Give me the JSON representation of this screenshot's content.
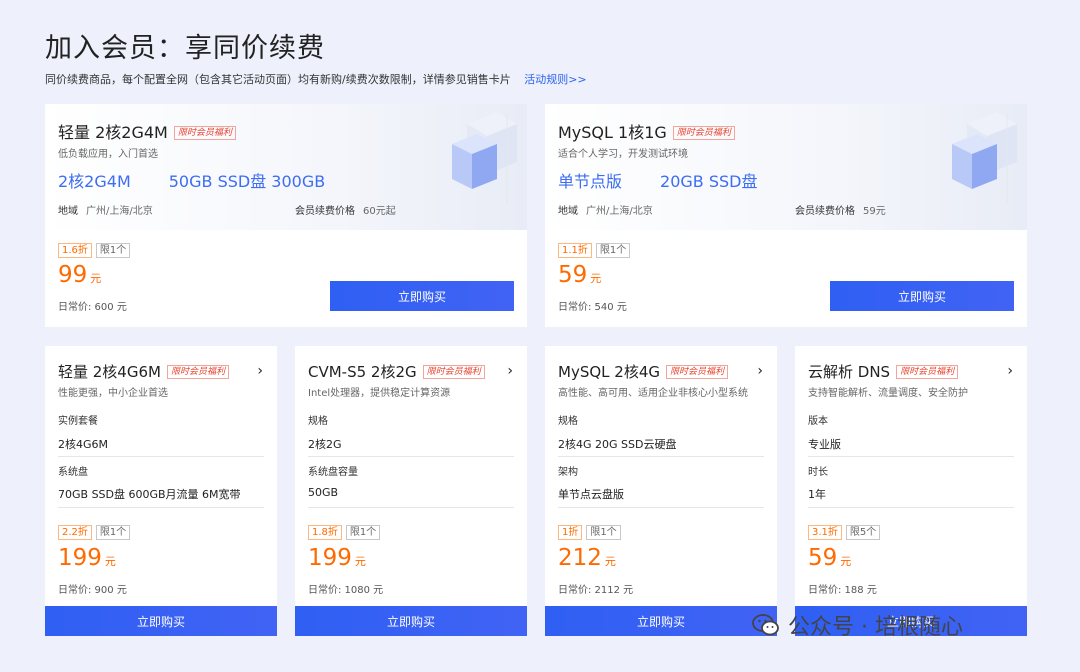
{
  "header": {
    "title": "加入会员：享同价续费",
    "subtitle": "同价续费商品，每个配置全网（包含其它活动页面）均有新购/续费次数限制，详情参见销售卡片",
    "rules_link": "活动规则>>"
  },
  "big_cards": [
    {
      "title": "轻量 2核2G4M",
      "badge": "限时会员福利",
      "desc": "低负载应用，入门首选",
      "spec1": "2核2G4M",
      "spec2": "50GB SSD盘 300GB",
      "region_label": "地域",
      "region_value": "广州/上海/北京",
      "renew_label": "会员续费价格",
      "renew_value": "60元起",
      "discount": "1.6折",
      "limit": "限1个",
      "price": "99",
      "unit": "元",
      "regular": "日常价: 600 元",
      "buy": "立即购买"
    },
    {
      "title": "MySQL 1核1G",
      "badge": "限时会员福利",
      "desc": "适合个人学习，开发测试环境",
      "spec1": "单节点版",
      "spec2": "20GB SSD盘",
      "region_label": "地域",
      "region_value": "广州/上海/北京",
      "renew_label": "会员续费价格",
      "renew_value": "59元",
      "discount": "1.1折",
      "limit": "限1个",
      "price": "59",
      "unit": "元",
      "regular": "日常价: 540 元",
      "buy": "立即购买"
    }
  ],
  "small_cards": [
    {
      "title": "轻量 2核4G6M",
      "badge": "限时会员福利",
      "desc": "性能更强，中小企业首选",
      "f1_label": "实例套餐",
      "f1_value": "2核4G6M",
      "f2_label": "系统盘",
      "f2_value": "70GB SSD盘 600GB月流量 6M宽带",
      "discount": "2.2折",
      "limit": "限1个",
      "price": "199",
      "unit": "元",
      "regular": "日常价: 900 元",
      "buy": "立即购买"
    },
    {
      "title": "CVM-S5 2核2G",
      "badge": "限时会员福利",
      "desc": "Intel处理器，提供稳定计算资源",
      "f1_label": "规格",
      "f1_value": "2核2G",
      "f2_label": "系统盘容量",
      "f2_value": "50GB",
      "discount": "1.8折",
      "limit": "限1个",
      "price": "199",
      "unit": "元",
      "regular": "日常价: 1080 元",
      "buy": "立即购买"
    },
    {
      "title": "MySQL 2核4G",
      "badge": "限时会员福利",
      "desc": "高性能、高可用、适用企业非核心小型系统",
      "f1_label": "规格",
      "f1_value": "2核4G 20G SSD云硬盘",
      "f2_label": "架构",
      "f2_value": "单节点云盘版",
      "discount": "1折",
      "limit": "限1个",
      "price": "212",
      "unit": "元",
      "regular": "日常价: 2112 元",
      "buy": "立即购买"
    },
    {
      "title": "云解析 DNS",
      "badge": "限时会员福利",
      "desc": "支持智能解析、流量调度、安全防护",
      "f1_label": "版本",
      "f1_value": "专业版",
      "f2_label": "时长",
      "f2_value": "1年",
      "discount": "3.1折",
      "limit": "限5个",
      "price": "59",
      "unit": "元",
      "regular": "日常价: 188 元",
      "buy": "立即购买"
    }
  ],
  "watermark": {
    "text": "公众号 · 培根随心",
    "icon": "wechat-icon"
  },
  "colors": {
    "accent_blue": "#2f5ff3",
    "price_orange": "#ff6a00",
    "background": "#eef1fb"
  }
}
